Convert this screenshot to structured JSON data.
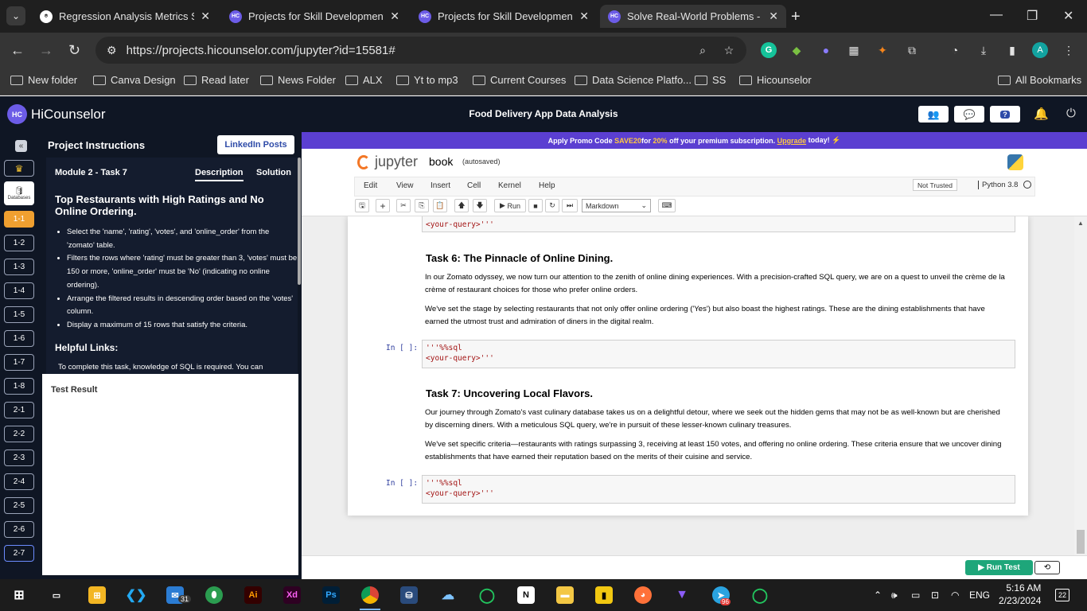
{
  "browser": {
    "tabs": [
      {
        "title": "Regression Analysis Metrics Sur",
        "favicon": "chatgpt-icon",
        "active": false
      },
      {
        "title": "Projects for Skill Development: H",
        "favicon": "HC",
        "active": false
      },
      {
        "title": "Projects for Skill Development: H",
        "favicon": "HC",
        "active": false
      },
      {
        "title": "Solve Real-World Problems - Hi",
        "favicon": "HC",
        "active": true
      }
    ],
    "url": "https://projects.hicounselor.com/jupyter?id=15581#",
    "profile_initial": "A",
    "bookmarks": [
      "New folder",
      "Canva Design",
      "Read later",
      "News Folder",
      "ALX",
      "Yt to mp3",
      "Current Courses",
      "Data Science Platfo...",
      "SS",
      "Hicounselor"
    ],
    "all_bookmarks": "All Bookmarks"
  },
  "app": {
    "logo_mark": "HC",
    "logo_text": "HiCounselor",
    "title": "Food Delivery App Data Analysis"
  },
  "rail": {
    "collapse": "«",
    "db_label": "Databases",
    "items": [
      "1-1",
      "1-2",
      "1-3",
      "1-4",
      "1-5",
      "1-6",
      "1-7",
      "1-8",
      "2-1",
      "2-2",
      "2-3",
      "2-4",
      "2-5",
      "2-6",
      "2-7"
    ]
  },
  "instructions": {
    "header": "Project Instructions",
    "linkedin": "LinkedIn Posts",
    "task_label": "Module 2 - Task 7",
    "tab_description": "Description",
    "tab_solution": "Solution",
    "task_title": "Top Restaurants with High Ratings and No Online Ordering.",
    "bullets": [
      "Select the 'name', 'rating', 'votes', and 'online_order' from the 'zomato' table.",
      "Filters the rows where 'rating' must be greater than 3, 'votes' must be 150 or more, 'online_order' must be 'No' (indicating no online ordering).",
      "Arrange the filtered results in descending order based on the 'votes' column.",
      "Display a maximum of 15 rows that satisfy the criteria."
    ],
    "helpful_heading": "Helpful Links:",
    "helpful_text": "To complete this task, knowledge of SQL is required. You can",
    "test_result": "Test Result"
  },
  "promo": {
    "pre": "Apply Promo Code ",
    "code": "SAVE20",
    "mid": " for ",
    "pct": "20%",
    "post": " off your premium subscription. ",
    "link": "Upgrade",
    "end": " today! ⚡"
  },
  "jupyter": {
    "brand": "jupyter",
    "notebook": "book",
    "saved": "(autosaved)",
    "menu": [
      "Edit",
      "View",
      "Insert",
      "Cell",
      "Kernel",
      "Help"
    ],
    "trusted": "Not Trusted",
    "kernel": "Python 3.8",
    "run": "Run",
    "cell_type": "Markdown"
  },
  "notebook": {
    "top_cell_line": "<your-query>'''",
    "task6_title": "Task 6: The Pinnacle of Online Dining.",
    "task6_p1": "In our Zomato odyssey, we now turn our attention to the zenith of online dining experiences. With a precision-crafted SQL query, we are on a quest to unveil the crème de la crème of restaurant choices for those who prefer online orders.",
    "task6_p2": "We've set the stage by selecting restaurants that not only offer online ordering ('Yes') but also boast the highest ratings. These are the dining establishments that have earned the utmost trust and admiration of diners in the digital realm.",
    "prompt": "In [ ]:",
    "code_line1": "'''%%sql",
    "code_line2": "<your-query>'''",
    "task7_title": "Task 7: Uncovering Local Flavors.",
    "task7_p1": "Our journey through Zomato's vast culinary database takes us on a delightful detour, where we seek out the hidden gems that may not be as well-known but are cherished by discerning diners. With a meticulous SQL query, we're in pursuit of these lesser-known culinary treasures.",
    "task7_p2": "We've set specific criteria—restaurants with ratings surpassing 3, receiving at least 150 votes, and offering no online ordering. These criteria ensure that we uncover dining establishments that have earned their reputation based on the merits of their cuisine and service."
  },
  "footer": {
    "run_test": "Run Test"
  },
  "taskbar": {
    "mail_badge": "31",
    "telegram_badge": "96",
    "lang": "ENG",
    "time": "5:16 AM",
    "date": "2/23/2024",
    "notif_count": "22"
  }
}
